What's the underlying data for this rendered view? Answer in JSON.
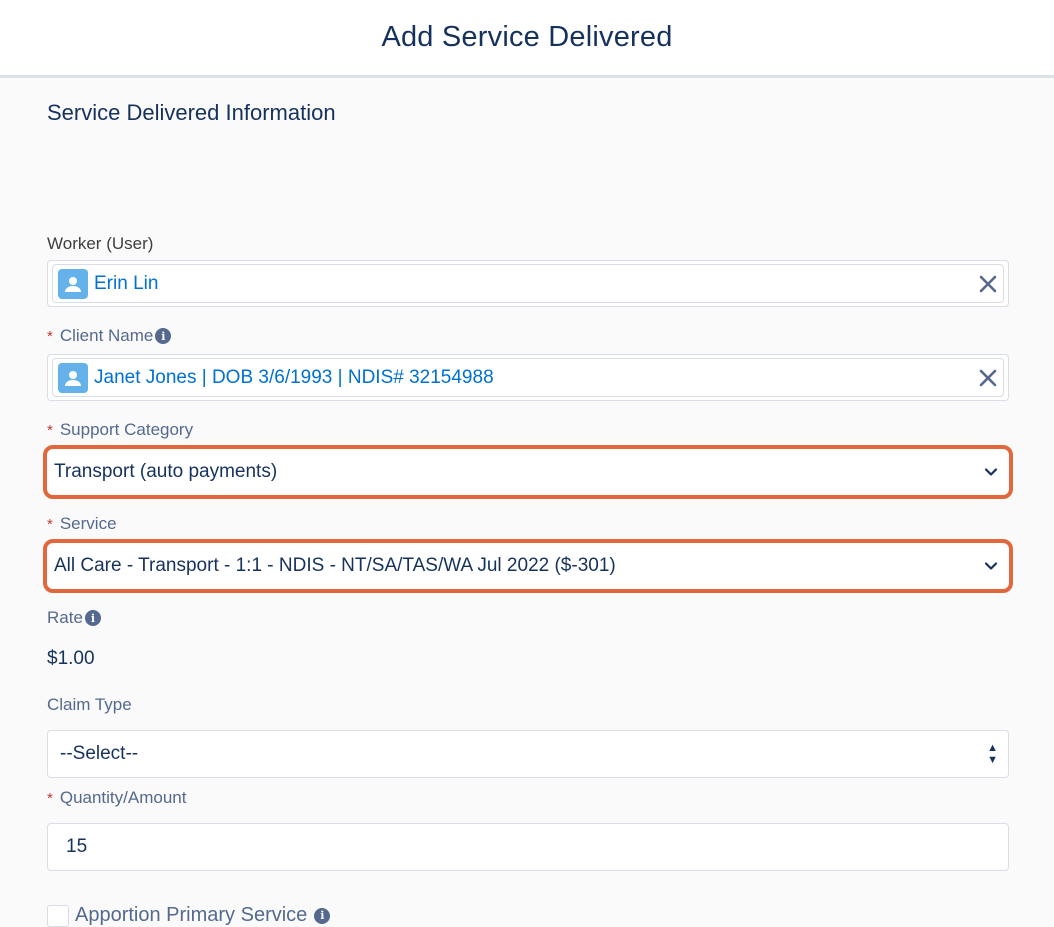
{
  "header": {
    "title": "Add Service Delivered"
  },
  "section": {
    "title": "Service Delivered Information"
  },
  "worker": {
    "label": "Worker (User)",
    "value": "Erin Lin"
  },
  "client": {
    "required_mark": "*",
    "label": "Client Name",
    "value": "Janet Jones | DOB 3/6/1993 | NDIS# 32154988"
  },
  "support_category": {
    "required_mark": "*",
    "label": "Support Category",
    "value": "Transport (auto payments)"
  },
  "service": {
    "required_mark": "*",
    "label": "Service",
    "value": "All Care - Transport - 1:1 - NDIS - NT/SA/TAS/WA Jul 2022 ($-301)"
  },
  "rate": {
    "label": "Rate",
    "value": "$1.00"
  },
  "claim_type": {
    "label": "Claim Type",
    "value": "--Select--"
  },
  "quantity": {
    "required_mark": "*",
    "label": "Quantity/Amount",
    "value": "15"
  },
  "apportion": {
    "label": "Apportion Primary Service",
    "checked": false
  },
  "colors": {
    "accent": "#0070d2",
    "highlight": "#e2673d",
    "required": "#c23934"
  },
  "icons": {
    "info": "info-icon",
    "user": "user-icon",
    "clear": "close-icon",
    "chevron": "chevron-down-icon"
  }
}
